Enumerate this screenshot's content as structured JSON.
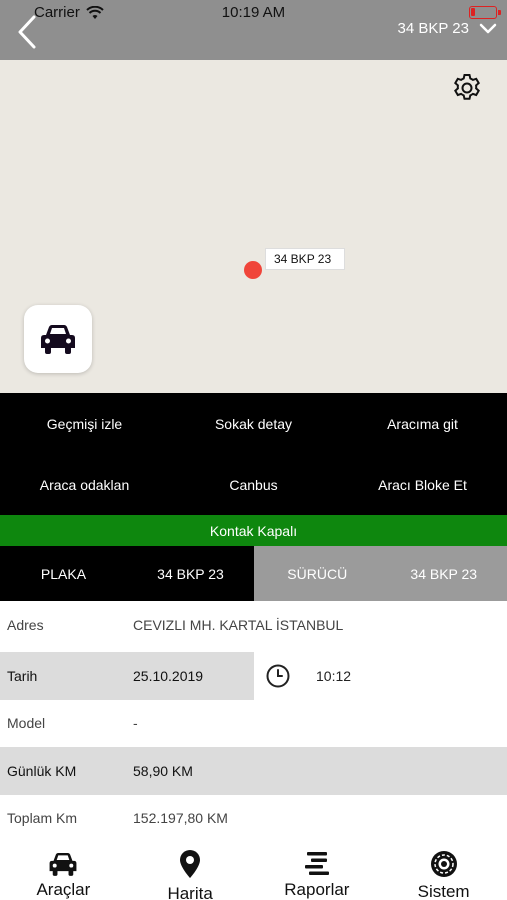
{
  "status_bar": {
    "carrier": "Carrier",
    "time": "10:19 AM",
    "battery_level": 0.15
  },
  "header": {
    "vehicle_plate": "34 BKP 23"
  },
  "map": {
    "marker_label": "34 BKP 23"
  },
  "actions": [
    {
      "label": "Geçmişi izle"
    },
    {
      "label": "Sokak detay"
    },
    {
      "label": "Aracıma git"
    },
    {
      "label": "Araca odaklan"
    },
    {
      "label": "Canbus"
    },
    {
      "label": "Aracı Bloke Et"
    }
  ],
  "ignition_status": "Kontak Kapalı",
  "plate_row": {
    "plate_label": "PLAKA",
    "plate_value": "34 BKP 23",
    "driver_label": "SÜRÜCÜ",
    "driver_value": "34 BKP 23"
  },
  "info": {
    "address": {
      "label": "Adres",
      "value": "CEVIZLI MH. KARTAL İSTANBUL"
    },
    "date": {
      "label": "Tarih",
      "value": "25.10.2019",
      "time": "10:12"
    },
    "model": {
      "label": "Model",
      "value": "-"
    },
    "daily_km": {
      "label": "Günlük KM",
      "value": "58,90 KM"
    },
    "total_km": {
      "label": "Toplam Km",
      "value": "152.197,80 KM"
    }
  },
  "tabs": [
    {
      "label": "Araçlar",
      "icon": "car-icon"
    },
    {
      "label": "Harita",
      "icon": "location-pin-icon"
    },
    {
      "label": "Raporlar",
      "icon": "reports-icon"
    },
    {
      "label": "Sistem",
      "icon": "system-icon"
    }
  ],
  "colors": {
    "header": "#8f8f8f",
    "map": "#ebe8e1",
    "marker": "#f0453a",
    "ignition_bar": "#0e870e",
    "battery": "#dd2222"
  }
}
